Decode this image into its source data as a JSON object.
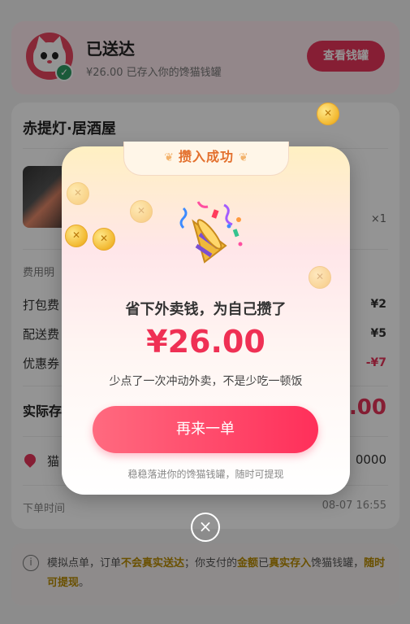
{
  "status": {
    "title": "已送达",
    "subtitle": "¥26.00 已存入你的馋猫钱罐",
    "view_button": "查看钱罐"
  },
  "order": {
    "shop_name": "赤提灯·居酒屋",
    "quantity": "×1",
    "fees_title": "费用明",
    "fees": [
      {
        "label": "打包费",
        "value": "¥2"
      },
      {
        "label": "配送费",
        "value": "¥5"
      },
      {
        "label": "优惠券",
        "value": "-¥7"
      }
    ],
    "actual_label": "实际存",
    "actual_value": "26.00",
    "address_label": "猫",
    "address_value": "0000",
    "time_label": "下单时间",
    "time_value": "08-07 16:55"
  },
  "notice": {
    "icon": "i",
    "parts": {
      "p1": "模拟点单，订单",
      "h1": "不会真实送达",
      "p2": "；你支付的",
      "h2": "金额",
      "p3": "已",
      "h3": "真实存入",
      "p4": "馋猫钱罐，",
      "h4": "随时可提现",
      "p5": "。"
    }
  },
  "modal": {
    "tab_title": "攒入成功",
    "headline": "省下外卖钱，为自己攒了",
    "amount": "¥26.00",
    "description": "少点了一次冲动外卖，不是少吃一顿饭",
    "reorder_button": "再来一单",
    "footer": "稳稳落进你的馋猫钱罐，随时可提现",
    "close_icon": "×",
    "coin_glyph": "✕"
  },
  "colors": {
    "accent": "#ef3054",
    "button_start": "#ff6a7f",
    "button_end": "#ff2f5a",
    "tab_text": "#e36f2c",
    "coin": "#f2b830",
    "success": "#2e9b63"
  }
}
